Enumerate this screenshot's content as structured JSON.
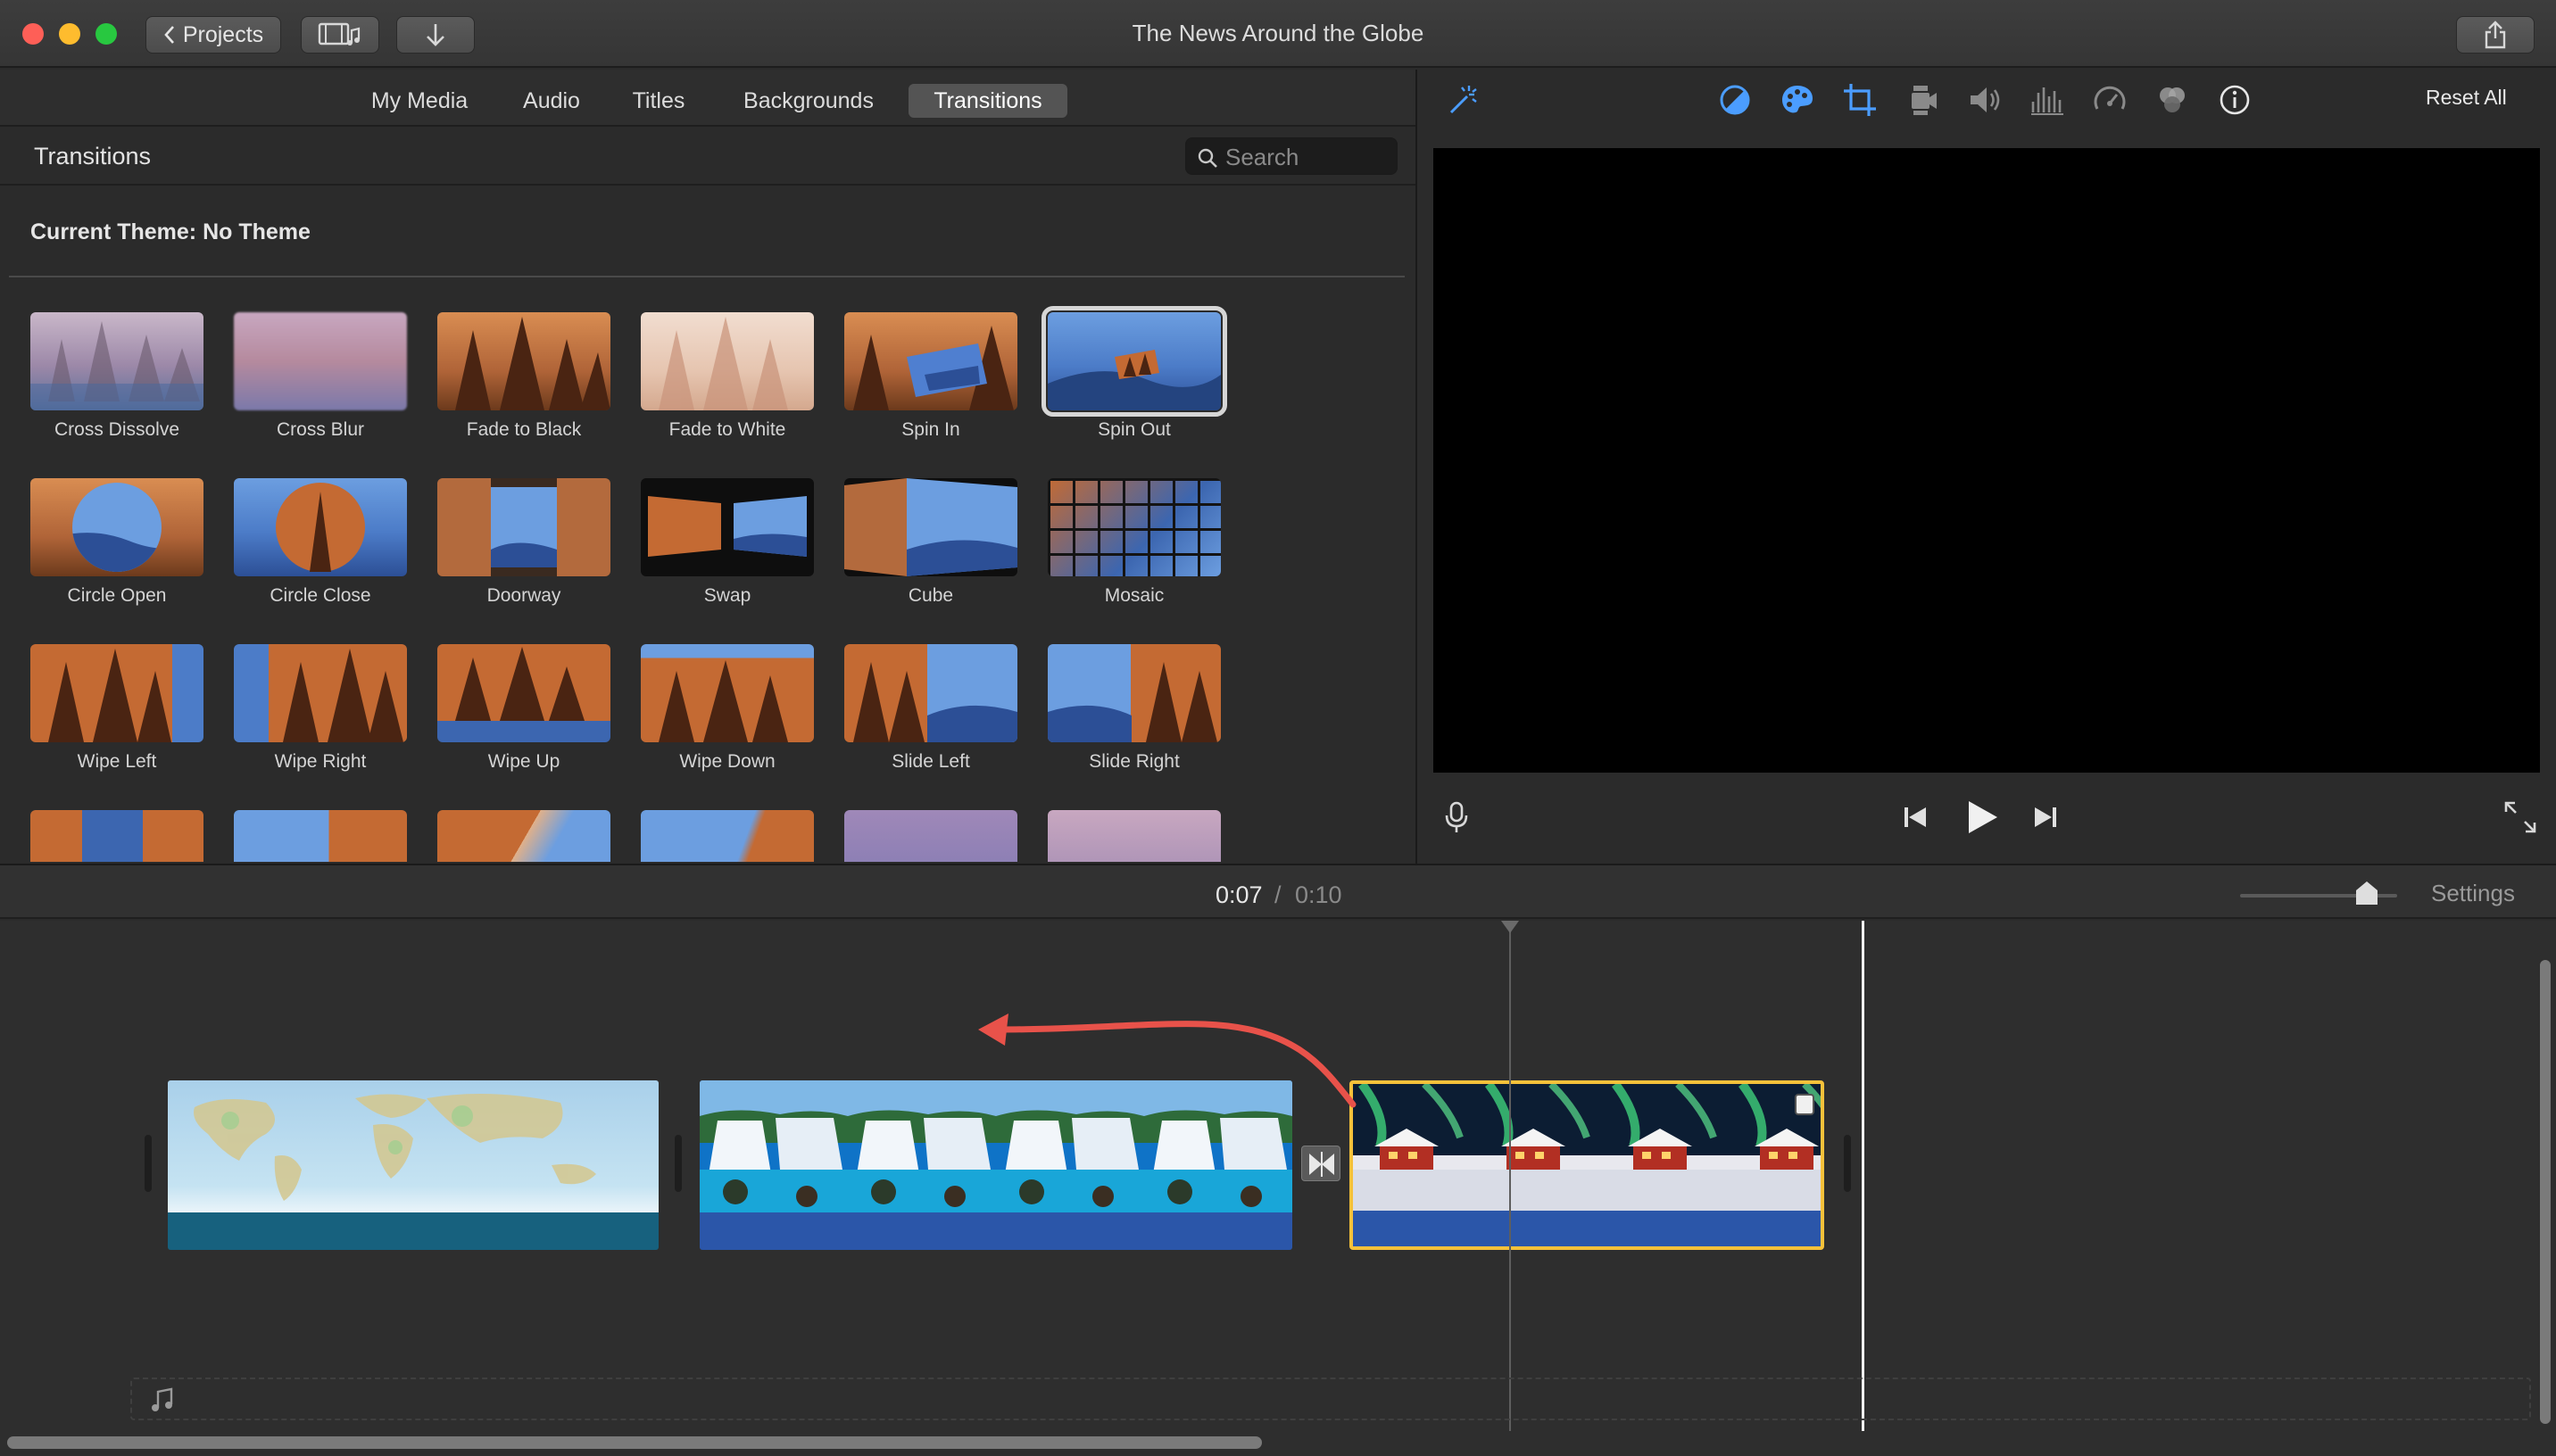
{
  "window": {
    "title": "The News Around the Globe"
  },
  "toolbar": {
    "projects_label": "Projects"
  },
  "browser": {
    "tabs": [
      "My Media",
      "Audio",
      "Titles",
      "Backgrounds",
      "Transitions"
    ],
    "selected_tab": "Transitions",
    "section_title": "Transitions",
    "search_placeholder": "Search",
    "theme_label": "Current Theme: No Theme",
    "transitions": [
      "Cross Dissolve",
      "Cross Blur",
      "Fade to Black",
      "Fade to White",
      "Spin In",
      "Spin Out",
      "Circle Open",
      "Circle Close",
      "Doorway",
      "Swap",
      "Cube",
      "Mosaic",
      "Wipe Left",
      "Wipe Right",
      "Wipe Up",
      "Wipe Down",
      "Slide Left",
      "Slide Right"
    ],
    "selected_transition": "Spin Out"
  },
  "viewer": {
    "reset_label": "Reset All",
    "tool_icons": [
      "color-balance-icon",
      "color-correction-icon",
      "crop-icon",
      "stabilization-icon",
      "volume-icon",
      "noise-reduction-icon",
      "speed-icon",
      "clip-filter-icon",
      "info-icon"
    ]
  },
  "timeline": {
    "current_time": "0:07",
    "separator": "/",
    "total_time": "0:10",
    "settings_label": "Settings",
    "clips": [
      "world-map-clip",
      "waterfall-clip",
      "aurora-cabin-clip"
    ]
  },
  "colors": {
    "accent": "#4b9dff",
    "selection": "#f6c13a",
    "annotation_arrow": "#e8524a"
  }
}
